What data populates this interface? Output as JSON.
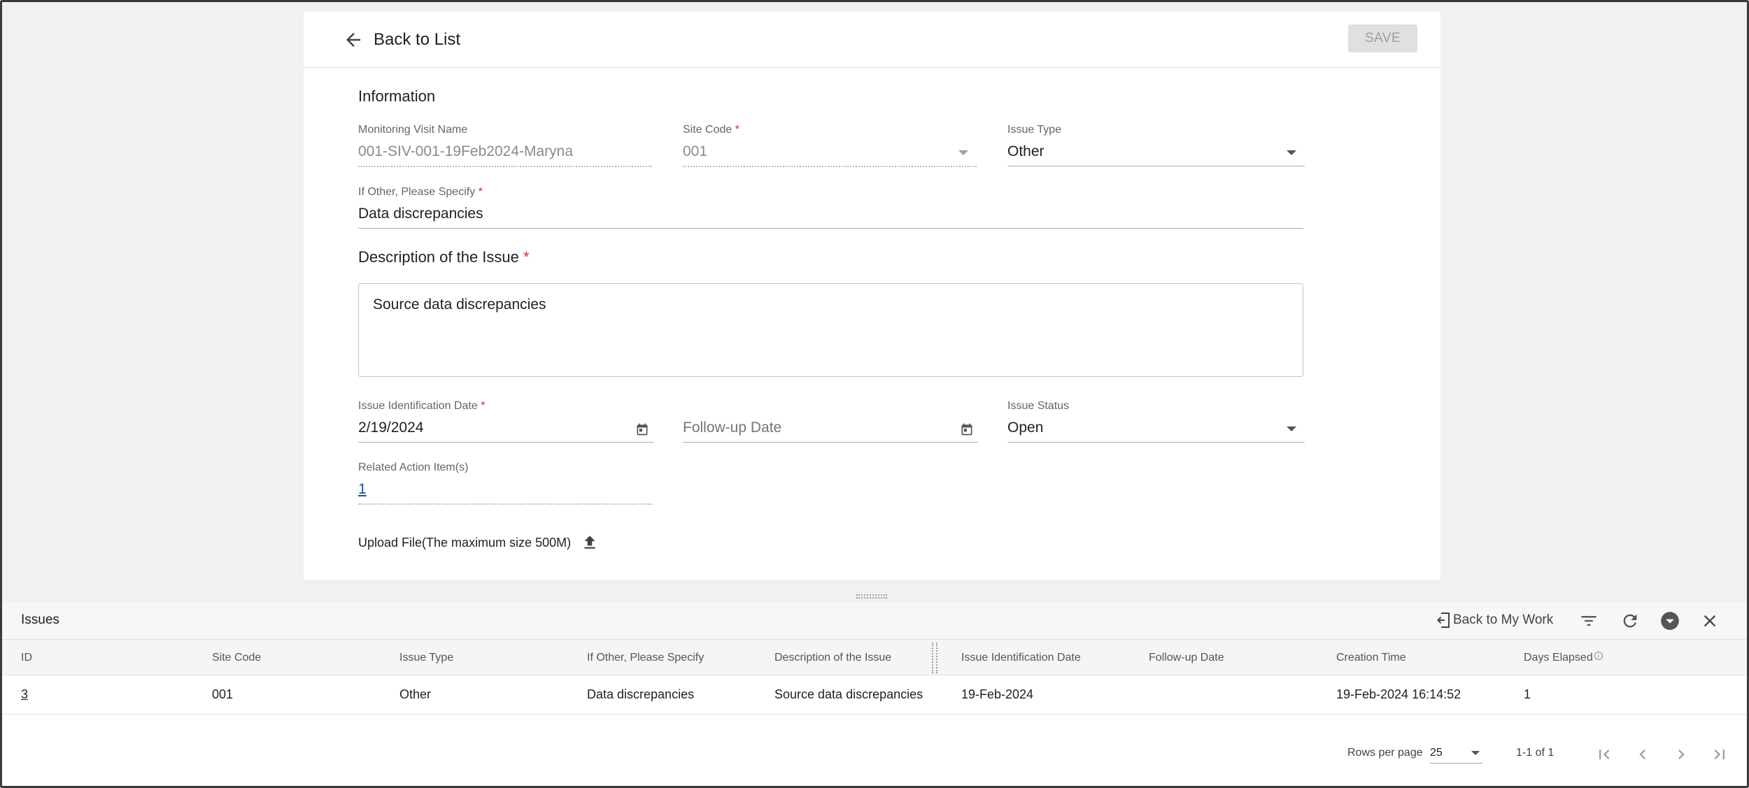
{
  "header": {
    "back_label": "Back to List",
    "save_label": "SAVE"
  },
  "form": {
    "section_information": "Information",
    "monitoring_visit": {
      "label": "Monitoring Visit Name",
      "value": "001-SIV-001-19Feb2024-Maryna"
    },
    "site_code": {
      "label": "Site Code",
      "value": "001"
    },
    "issue_type": {
      "label": "Issue Type",
      "value": "Other"
    },
    "if_other": {
      "label": "If Other, Please Specify",
      "value": "Data discrepancies"
    },
    "description": {
      "label": "Description of the Issue",
      "value": "Source data discrepancies"
    },
    "identification_date": {
      "label": "Issue Identification Date",
      "value": "2/19/2024"
    },
    "followup_date": {
      "placeholder": "Follow-up Date"
    },
    "issue_status": {
      "label": "Issue Status",
      "value": "Open"
    },
    "related_action": {
      "label": "Related Action Item(s)",
      "value": "1"
    },
    "required_mark": "*",
    "upload_label": "Upload File(The maximum size 500M)"
  },
  "panel": {
    "title": "Issues",
    "back_to_work": "Back to My Work",
    "columns": [
      "ID",
      "Site Code",
      "Issue Type",
      "If Other, Please Specify",
      "Description of the Issue",
      "Issue Identification Date",
      "Follow-up Date",
      "Creation Time",
      "Days Elapsed"
    ],
    "rows": [
      [
        "3",
        "001",
        "Other",
        "Data discrepancies",
        "Source data discrepancies",
        "19-Feb-2024",
        "",
        "19-Feb-2024 16:14:52",
        "1"
      ]
    ],
    "info_glyph": "i",
    "pagination": {
      "rows_per_page_label": "Rows per page",
      "rows_per_page": "25",
      "range": "1-1 of 1"
    }
  },
  "icons": {
    "back": "arrow-left-icon",
    "calendar": "calendar-icon",
    "upload": "upload-icon",
    "filter": "filter-icon",
    "refresh": "refresh-icon",
    "collapse": "chevron-down-circle-icon",
    "close": "close-icon",
    "first": "first-page-icon",
    "prev": "chevron-left-icon",
    "next": "chevron-right-icon",
    "last": "last-page-icon"
  },
  "colors": {
    "required": "#d32f2f",
    "link": "#1a4fa3",
    "save_disabled": "#e0e0e0"
  }
}
